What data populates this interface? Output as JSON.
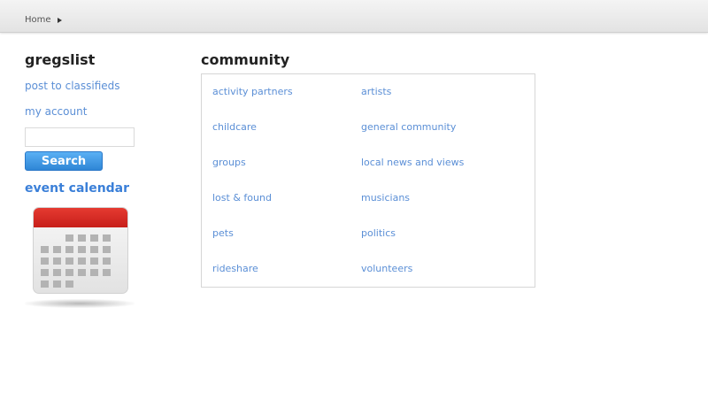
{
  "breadcrumb": {
    "home": "Home"
  },
  "sidebar": {
    "site_title": "gregslist",
    "post_link": "post to classifieds",
    "account_link": "my account",
    "search_value": "",
    "search_button": "Search",
    "event_calendar": "event calendar",
    "calendar_icon": "calendar-icon"
  },
  "main": {
    "section_title": "community",
    "categories_left": [
      "activity partners",
      "childcare",
      "groups",
      "lost & found",
      "pets",
      "rideshare"
    ],
    "categories_right": [
      "artists",
      "general community",
      "local news and views",
      "musicians",
      "politics",
      "volunteers"
    ]
  },
  "colors": {
    "link": "#5b8fd6",
    "button": "#2f86d6",
    "calendar_red": "#d72a24"
  }
}
